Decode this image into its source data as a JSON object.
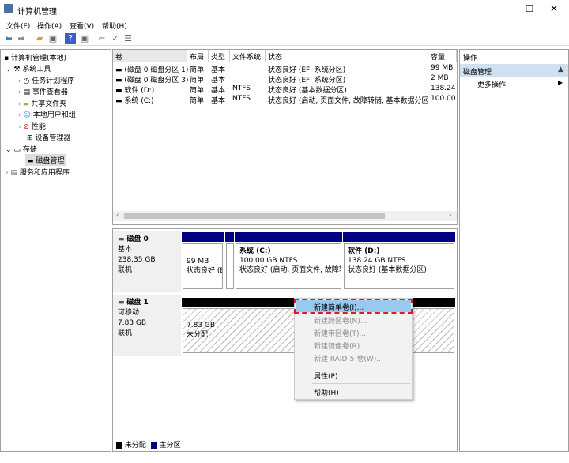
{
  "window": {
    "title": "计算机管理",
    "minimize": "—",
    "maximize": "☐",
    "close": "✕"
  },
  "menu": [
    "文件(F)",
    "操作(A)",
    "查看(V)",
    "帮助(H)"
  ],
  "toolbar_icons": [
    "back-icon",
    "forward-icon",
    "up-folder-icon",
    "show-tree-icon",
    "help-icon",
    "action-pane-icon",
    "connect-icon",
    "checklist-icon",
    "properties-icon"
  ],
  "tree": {
    "root": "计算机管理(本地)",
    "items": [
      {
        "label": "系统工具",
        "expanded": true
      },
      {
        "label": "任务计划程序"
      },
      {
        "label": "事件查看器"
      },
      {
        "label": "共享文件夹"
      },
      {
        "label": "本地用户和组"
      },
      {
        "label": "性能"
      },
      {
        "label": "设备管理器"
      },
      {
        "label": "存储",
        "expanded": true
      },
      {
        "label": "磁盘管理",
        "selected": true
      },
      {
        "label": "服务和应用程序"
      }
    ]
  },
  "volumes": {
    "headers": [
      "卷",
      "布局",
      "类型",
      "文件系统",
      "状态",
      "容量"
    ],
    "rows": [
      [
        "(磁盘 0 磁盘分区 1)",
        "简单",
        "基本",
        "",
        "状态良好 (EFI 系统分区)",
        "99 MB"
      ],
      [
        "(磁盘 0 磁盘分区 3)",
        "简单",
        "基本",
        "",
        "状态良好 (EFI 系统分区)",
        "2 MB"
      ],
      [
        "软件 (D:)",
        "简单",
        "基本",
        "NTFS",
        "状态良好 (基本数据分区)",
        "138.24"
      ],
      [
        "系统 (C:)",
        "简单",
        "基本",
        "NTFS",
        "状态良好 (启动, 页面文件, 故障转储, 基本数据分区)",
        "100.00"
      ]
    ]
  },
  "disk0": {
    "name": "磁盘 0",
    "type": "基本",
    "size": "238.35 GB",
    "status": "联机",
    "parts": [
      {
        "size": "99 MB",
        "status": "状态良好 (E"
      },
      {
        "name": "系统  (C:)",
        "size": "100.00 GB NTFS",
        "status": "状态良好 (启动, 页面文件, 故障转"
      },
      {
        "name": "软件  (D:)",
        "size": "138.24 GB NTFS",
        "status": "状态良好 (基本数据分区)"
      }
    ]
  },
  "disk1": {
    "name": "磁盘 1",
    "type": "可移动",
    "size": "7.83 GB",
    "status": "联机",
    "part": {
      "size": "7.83 GB",
      "status": "未分配"
    }
  },
  "context_menu": [
    {
      "label": "新建简单卷(I)...",
      "enabled": true,
      "highlighted": true
    },
    {
      "label": "新建跨区卷(N)...",
      "enabled": false
    },
    {
      "label": "新建带区卷(T)...",
      "enabled": false
    },
    {
      "label": "新建镜像卷(R)...",
      "enabled": false
    },
    {
      "label": "新建 RAID-5 卷(W)...",
      "enabled": false
    },
    {
      "label": "属性(P)",
      "enabled": true
    },
    {
      "label": "帮助(H)",
      "enabled": true
    }
  ],
  "legend": [
    {
      "label": "未分配",
      "color": "#000000"
    },
    {
      "label": "主分区",
      "color": "#000080"
    }
  ],
  "actions": {
    "header": "操作",
    "section": "磁盘管理",
    "more": "更多操作"
  },
  "colors": {
    "primary_partition": "#000080",
    "unallocated": "#000000",
    "highlight": "#99c9ef",
    "annotation": "#e0192a"
  }
}
